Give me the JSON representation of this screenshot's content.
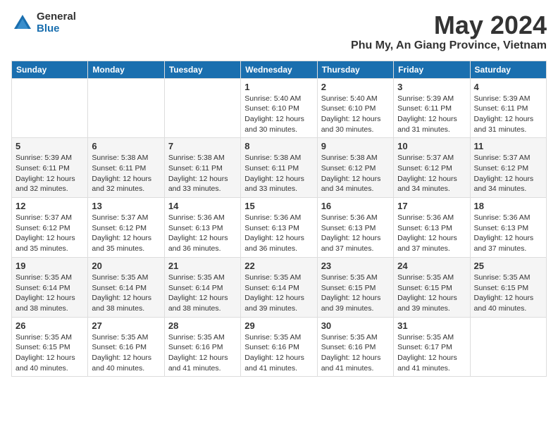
{
  "header": {
    "logo_general": "General",
    "logo_blue": "Blue",
    "month_title": "May 2024",
    "location": "Phu My, An Giang Province, Vietnam"
  },
  "weekdays": [
    "Sunday",
    "Monday",
    "Tuesday",
    "Wednesday",
    "Thursday",
    "Friday",
    "Saturday"
  ],
  "weeks": [
    [
      {
        "day": "",
        "info": ""
      },
      {
        "day": "",
        "info": ""
      },
      {
        "day": "",
        "info": ""
      },
      {
        "day": "1",
        "info": "Sunrise: 5:40 AM\nSunset: 6:10 PM\nDaylight: 12 hours\nand 30 minutes."
      },
      {
        "day": "2",
        "info": "Sunrise: 5:40 AM\nSunset: 6:10 PM\nDaylight: 12 hours\nand 30 minutes."
      },
      {
        "day": "3",
        "info": "Sunrise: 5:39 AM\nSunset: 6:11 PM\nDaylight: 12 hours\nand 31 minutes."
      },
      {
        "day": "4",
        "info": "Sunrise: 5:39 AM\nSunset: 6:11 PM\nDaylight: 12 hours\nand 31 minutes."
      }
    ],
    [
      {
        "day": "5",
        "info": "Sunrise: 5:39 AM\nSunset: 6:11 PM\nDaylight: 12 hours\nand 32 minutes."
      },
      {
        "day": "6",
        "info": "Sunrise: 5:38 AM\nSunset: 6:11 PM\nDaylight: 12 hours\nand 32 minutes."
      },
      {
        "day": "7",
        "info": "Sunrise: 5:38 AM\nSunset: 6:11 PM\nDaylight: 12 hours\nand 33 minutes."
      },
      {
        "day": "8",
        "info": "Sunrise: 5:38 AM\nSunset: 6:11 PM\nDaylight: 12 hours\nand 33 minutes."
      },
      {
        "day": "9",
        "info": "Sunrise: 5:38 AM\nSunset: 6:12 PM\nDaylight: 12 hours\nand 34 minutes."
      },
      {
        "day": "10",
        "info": "Sunrise: 5:37 AM\nSunset: 6:12 PM\nDaylight: 12 hours\nand 34 minutes."
      },
      {
        "day": "11",
        "info": "Sunrise: 5:37 AM\nSunset: 6:12 PM\nDaylight: 12 hours\nand 34 minutes."
      }
    ],
    [
      {
        "day": "12",
        "info": "Sunrise: 5:37 AM\nSunset: 6:12 PM\nDaylight: 12 hours\nand 35 minutes."
      },
      {
        "day": "13",
        "info": "Sunrise: 5:37 AM\nSunset: 6:12 PM\nDaylight: 12 hours\nand 35 minutes."
      },
      {
        "day": "14",
        "info": "Sunrise: 5:36 AM\nSunset: 6:13 PM\nDaylight: 12 hours\nand 36 minutes."
      },
      {
        "day": "15",
        "info": "Sunrise: 5:36 AM\nSunset: 6:13 PM\nDaylight: 12 hours\nand 36 minutes."
      },
      {
        "day": "16",
        "info": "Sunrise: 5:36 AM\nSunset: 6:13 PM\nDaylight: 12 hours\nand 37 minutes."
      },
      {
        "day": "17",
        "info": "Sunrise: 5:36 AM\nSunset: 6:13 PM\nDaylight: 12 hours\nand 37 minutes."
      },
      {
        "day": "18",
        "info": "Sunrise: 5:36 AM\nSunset: 6:13 PM\nDaylight: 12 hours\nand 37 minutes."
      }
    ],
    [
      {
        "day": "19",
        "info": "Sunrise: 5:35 AM\nSunset: 6:14 PM\nDaylight: 12 hours\nand 38 minutes."
      },
      {
        "day": "20",
        "info": "Sunrise: 5:35 AM\nSunset: 6:14 PM\nDaylight: 12 hours\nand 38 minutes."
      },
      {
        "day": "21",
        "info": "Sunrise: 5:35 AM\nSunset: 6:14 PM\nDaylight: 12 hours\nand 38 minutes."
      },
      {
        "day": "22",
        "info": "Sunrise: 5:35 AM\nSunset: 6:14 PM\nDaylight: 12 hours\nand 39 minutes."
      },
      {
        "day": "23",
        "info": "Sunrise: 5:35 AM\nSunset: 6:15 PM\nDaylight: 12 hours\nand 39 minutes."
      },
      {
        "day": "24",
        "info": "Sunrise: 5:35 AM\nSunset: 6:15 PM\nDaylight: 12 hours\nand 39 minutes."
      },
      {
        "day": "25",
        "info": "Sunrise: 5:35 AM\nSunset: 6:15 PM\nDaylight: 12 hours\nand 40 minutes."
      }
    ],
    [
      {
        "day": "26",
        "info": "Sunrise: 5:35 AM\nSunset: 6:15 PM\nDaylight: 12 hours\nand 40 minutes."
      },
      {
        "day": "27",
        "info": "Sunrise: 5:35 AM\nSunset: 6:16 PM\nDaylight: 12 hours\nand 40 minutes."
      },
      {
        "day": "28",
        "info": "Sunrise: 5:35 AM\nSunset: 6:16 PM\nDaylight: 12 hours\nand 41 minutes."
      },
      {
        "day": "29",
        "info": "Sunrise: 5:35 AM\nSunset: 6:16 PM\nDaylight: 12 hours\nand 41 minutes."
      },
      {
        "day": "30",
        "info": "Sunrise: 5:35 AM\nSunset: 6:16 PM\nDaylight: 12 hours\nand 41 minutes."
      },
      {
        "day": "31",
        "info": "Sunrise: 5:35 AM\nSunset: 6:17 PM\nDaylight: 12 hours\nand 41 minutes."
      },
      {
        "day": "",
        "info": ""
      }
    ]
  ]
}
